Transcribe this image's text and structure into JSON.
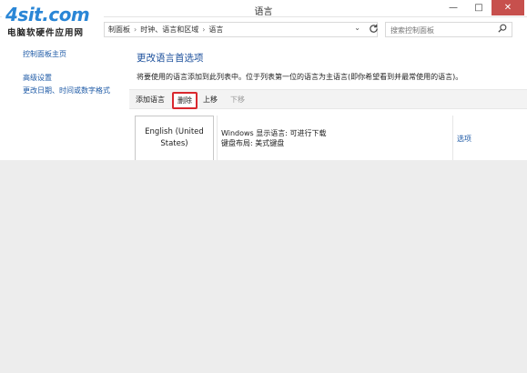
{
  "window": {
    "title": "语言"
  },
  "window_buttons": {
    "minimize": "—",
    "maximize": "□",
    "close": "✕"
  },
  "watermark": {
    "brand": "4sit.com",
    "tagline": "电脑软硬件应用网"
  },
  "address": {
    "crumbs": [
      "制面板",
      "时钟、语言和区域",
      "语言"
    ],
    "separator": "›",
    "dropdown": "⌄"
  },
  "search": {
    "placeholder": "搜索控制面板"
  },
  "sidebar": {
    "home": "控制面板主页",
    "items": [
      "高级设置",
      "更改日期、时间或数字格式"
    ]
  },
  "main": {
    "title": "更改语言首选项",
    "description": "将要使用的语言添加到此列表中。位于列表第一位的语言为主语言(即你希望看到并最常使用的语言)。"
  },
  "toolbar": {
    "add": "添加语言",
    "remove": "删除",
    "up": "上移",
    "down": "下移"
  },
  "language": {
    "name": "English (United States)",
    "display_language": "Windows 显示语言: 可进行下载",
    "keyboard_layout": "键盘布局: 美式键盘",
    "options": "选项"
  },
  "colors": {
    "accent_link": "#1e5aa6",
    "title_blue": "#1a4e9b",
    "highlight_red": "#d9282e",
    "close_button": "#c7504d",
    "watermark_blue": "#2a86d6"
  },
  "icons": {
    "refresh": "refresh-icon",
    "search": "search-icon"
  }
}
